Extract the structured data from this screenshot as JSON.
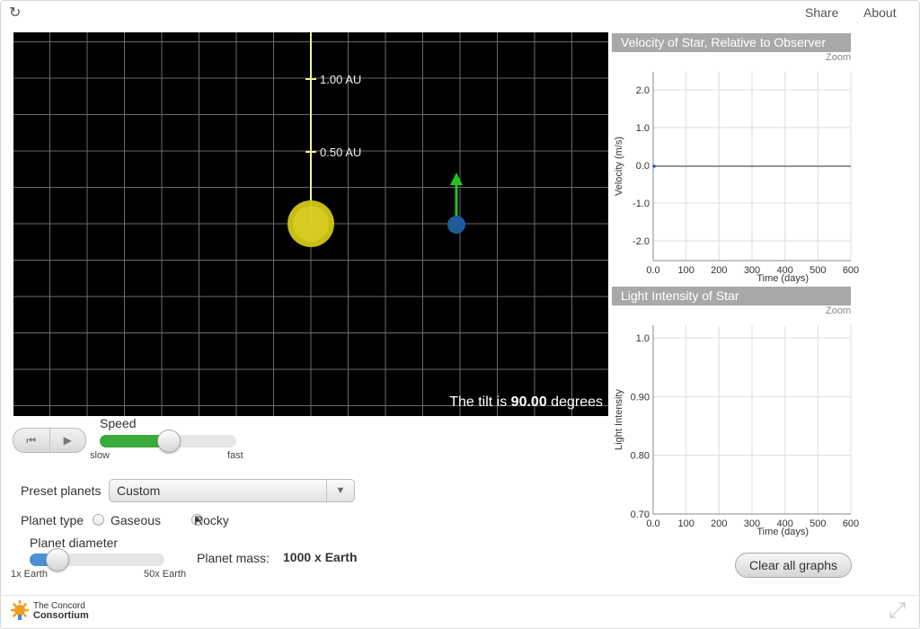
{
  "topbar": {
    "reload_icon": "↻",
    "share_label": "Share",
    "about_label": "About"
  },
  "simulation": {
    "au_labels": [
      "1.00 AU",
      "0.50 AU"
    ],
    "tilt_prefix": "The tilt is",
    "tilt_value": "90.00",
    "tilt_suffix": "degrees",
    "colors": {
      "background": "#000000",
      "star": "#d4c617",
      "planet": "#1f5b9a",
      "arrow": "#22c422"
    }
  },
  "velocity_graph": {
    "title": "Velocity of Star, Relative to Observer",
    "zoom_label": "Zoom",
    "ylabel": "Velocity (m/s)",
    "xlabel": "Time (days)",
    "y_ticks": [
      "2.0",
      "1.0",
      "0.0",
      "-1.0",
      "-2.0"
    ],
    "x_ticks": [
      "0.0",
      "100",
      "200",
      "300",
      "400",
      "500",
      "600"
    ]
  },
  "light_graph": {
    "title": "Light Intensity of Star",
    "zoom_label": "Zoom",
    "ylabel": "Light Intensity",
    "xlabel": "Time (days)",
    "y_ticks": [
      "1.0",
      "0.90",
      "0.80",
      "0.70"
    ],
    "x_ticks": [
      "0.0",
      "100",
      "200",
      "300",
      "400",
      "500",
      "600"
    ]
  },
  "controls": {
    "reset_icon": "⏮",
    "play_icon": "▶",
    "speed_label": "Speed",
    "speed_min_label": "slow",
    "speed_max_label": "fast",
    "speed_fraction": 0.5,
    "speed_color": "#3aaa3a",
    "preset_label": "Preset planets",
    "preset_value": "Custom",
    "planet_type_label": "Planet type",
    "planet_types": [
      "Gaseous",
      "Rocky"
    ],
    "planet_type_selected": "Rocky",
    "diameter_label": "Planet diameter",
    "diameter_min_label": "1x Earth",
    "diameter_max_label": "50x Earth",
    "diameter_fraction": 0.2,
    "diameter_color": "#4a90d9",
    "mass_label": "Planet mass:",
    "mass_value": "1000 x Earth",
    "clear_label": "Clear all graphs"
  },
  "footer": {
    "logo_line1": "The Concord",
    "logo_line2": "Consortium",
    "fullscreen_icon": "⤢"
  }
}
